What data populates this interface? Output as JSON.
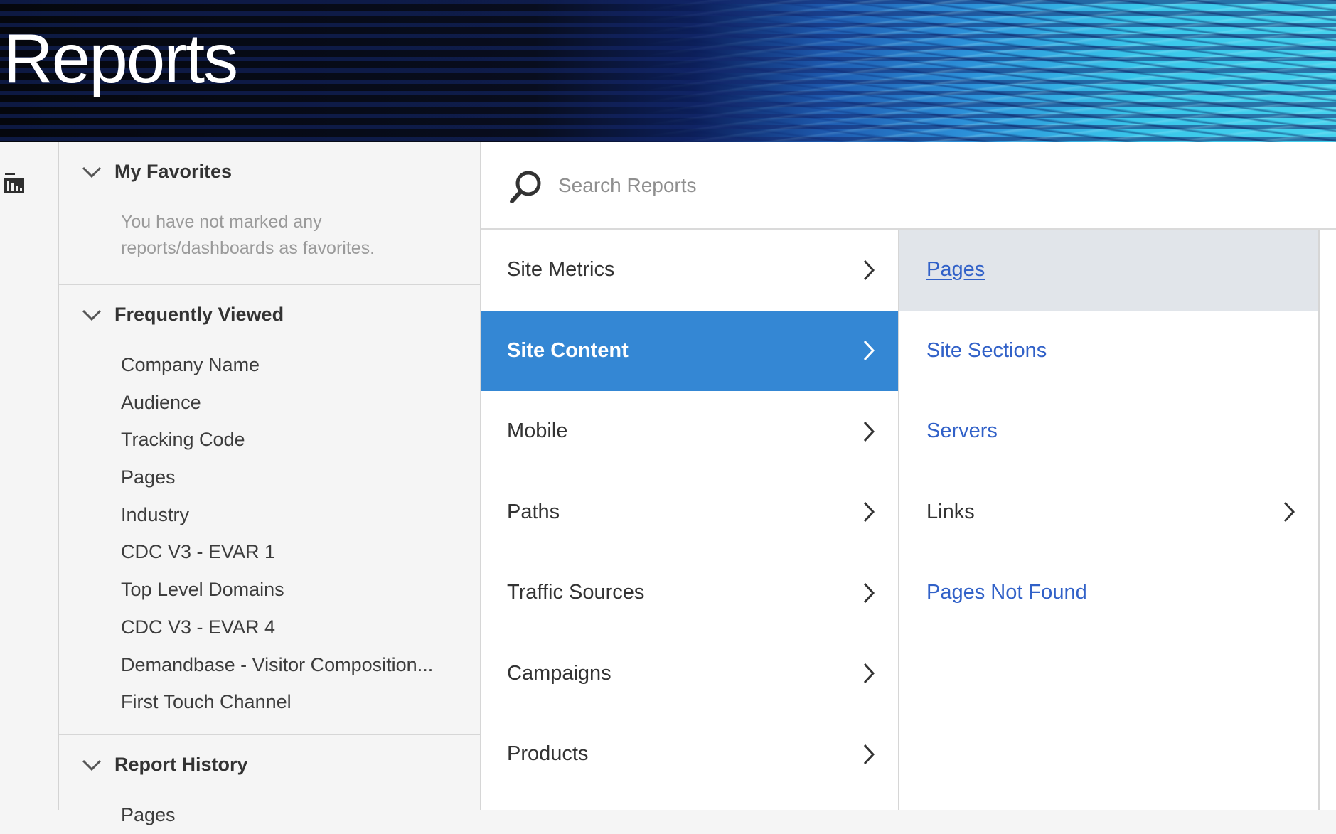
{
  "header": {
    "title": "Reports"
  },
  "rail": {
    "icon": "reports-icon"
  },
  "sidebar": {
    "favorites": {
      "title": "My Favorites",
      "empty_message": "You have not marked any reports/dashboards as favorites."
    },
    "frequently_viewed": {
      "title": "Frequently Viewed",
      "items": [
        "Company Name",
        "Audience",
        "Tracking Code",
        "Pages",
        "Industry",
        "CDC V3 - EVAR 1",
        "Top Level Domains",
        "CDC V3 - EVAR 4",
        "Demandbase - Visitor Composition...",
        "First Touch Channel"
      ]
    },
    "report_history": {
      "title": "Report History",
      "items": [
        "Pages"
      ]
    }
  },
  "search": {
    "placeholder": "Search Reports",
    "value": ""
  },
  "categories": {
    "items": [
      {
        "label": "Site Metrics",
        "has_children": true,
        "selected": false
      },
      {
        "label": "Site Content",
        "has_children": true,
        "selected": true
      },
      {
        "label": "Mobile",
        "has_children": true,
        "selected": false
      },
      {
        "label": "Paths",
        "has_children": true,
        "selected": false
      },
      {
        "label": "Traffic Sources",
        "has_children": true,
        "selected": false
      },
      {
        "label": "Campaigns",
        "has_children": true,
        "selected": false
      },
      {
        "label": "Products",
        "has_children": true,
        "selected": false
      }
    ]
  },
  "subcategories": {
    "items": [
      {
        "label": "Pages",
        "type": "link",
        "hovered": true
      },
      {
        "label": "Site Sections",
        "type": "link",
        "hovered": false
      },
      {
        "label": "Servers",
        "type": "link",
        "hovered": false
      },
      {
        "label": "Links",
        "type": "folder",
        "hovered": false
      },
      {
        "label": "Pages Not Found",
        "type": "link",
        "hovered": false
      }
    ]
  },
  "colors": {
    "accent": "#3487d4",
    "link": "#3161c8",
    "hover_row": "#e1e5ea",
    "text": "#333333",
    "muted": "#9a9a9a"
  }
}
